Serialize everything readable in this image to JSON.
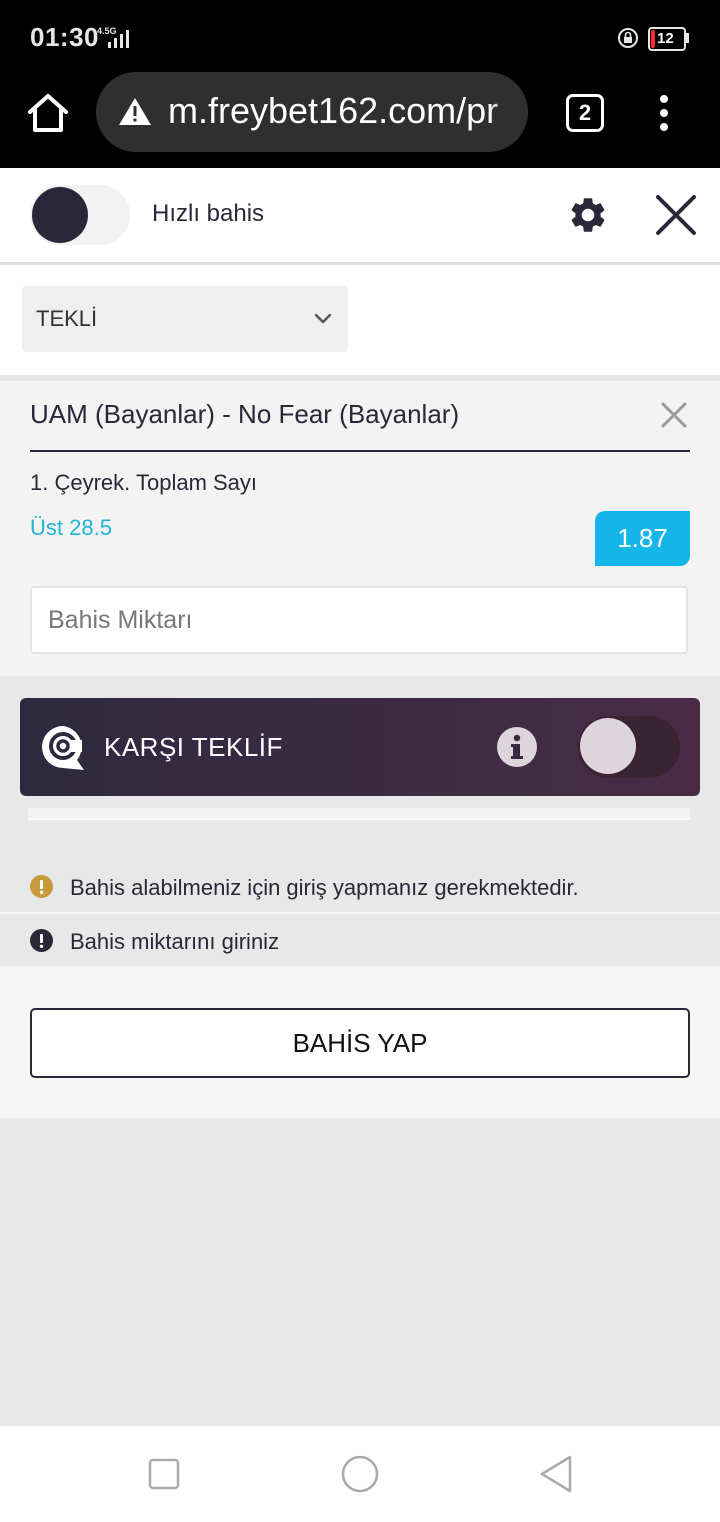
{
  "status_bar": {
    "time": "01:30",
    "network": "4.5G",
    "battery": "12"
  },
  "browser": {
    "url": "m.freybet162.com/pr",
    "tab_count": "2"
  },
  "header": {
    "quick_bet_label": "Hızlı bahis"
  },
  "bet_type": {
    "selected": "TEKLİ"
  },
  "bet": {
    "match": "UAM (Bayanlar) - No Fear (Bayanlar)",
    "market": "1. Çeyrek. Toplam Sayı",
    "selection": "Üst 28.5",
    "odds": "1.87",
    "amount_placeholder": "Bahis Miktarı"
  },
  "counter_offer": {
    "label": "KARŞI TEKLİF",
    "enabled": false
  },
  "messages": [
    {
      "icon": "warning-icon",
      "text": "Bahis alabilmeniz için giriş yapmanız gerekmektedir."
    },
    {
      "icon": "alert-icon",
      "text": "Bahis miktarını giriniz"
    }
  ],
  "actions": {
    "place_bet_label": "BAHİS YAP"
  },
  "colors": {
    "accent": "#14b6ea",
    "selection_text": "#22b3d8",
    "warning": "#c79a3c",
    "dark": "#2a2838",
    "counter_offer_gradient": [
      "#2d2a40",
      "#4a2b47"
    ]
  }
}
